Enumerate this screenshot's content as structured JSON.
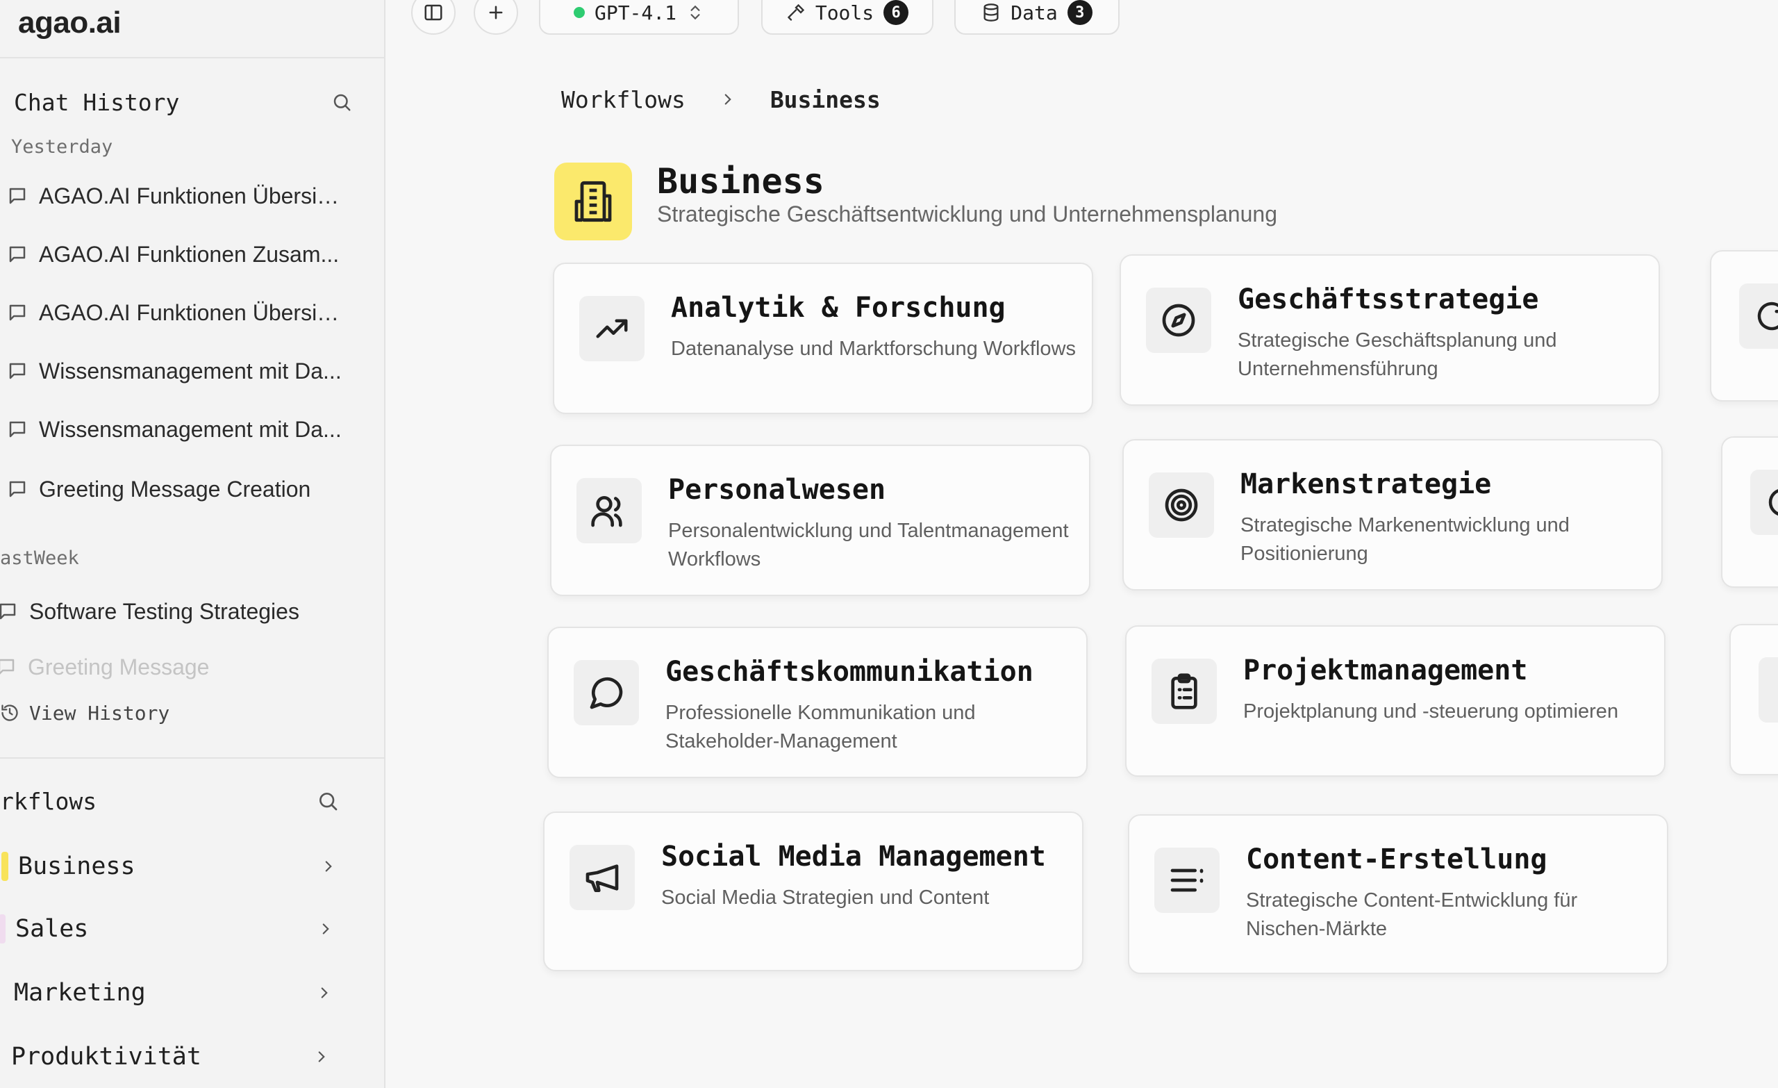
{
  "brand": "agao.ai",
  "sidebar": {
    "chat_history": {
      "title": "Chat History",
      "groups": [
        {
          "label": "Yesterday",
          "items": [
            "AGAO.AI Funktionen Übersic...",
            "AGAO.AI Funktionen Zusam...",
            "AGAO.AI Funktionen Übersic...",
            "Wissensmanagement mit Da...",
            "Wissensmanagement mit Da...",
            "Greeting Message Creation"
          ]
        },
        {
          "label": "astWeek",
          "items": [
            "Software Testing Strategies",
            "Greeting Message"
          ]
        }
      ],
      "view_history": "View History"
    },
    "workflows": {
      "title": "rkflows",
      "items": [
        "Business",
        "Sales",
        "Marketing",
        "Produktivität"
      ]
    }
  },
  "toolbar": {
    "model": "GPT-4.1",
    "tools_label": "Tools",
    "tools_count": "6",
    "data_label": "Data",
    "data_count": "3"
  },
  "breadcrumb": {
    "root": "Workflows",
    "current": "Business"
  },
  "header": {
    "title": "Business",
    "subtitle": "Strategische Geschäftsentwicklung und Unternehmensplanung"
  },
  "cards": [
    {
      "title": "Analytik & Forschung",
      "desc": "Datenanalyse und Marktforschung Workflows",
      "icon": "trending-up-icon"
    },
    {
      "title": "Geschäftsstrategie",
      "desc": "Strategische Geschäftsplanung und Unternehmensführung",
      "icon": "compass-icon"
    },
    {
      "title": "Personalwesen",
      "desc": "Personalentwicklung und Talentmanagement Workflows",
      "icon": "users-icon"
    },
    {
      "title": "Markenstrategie",
      "desc": "Strategische Markenentwicklung und Positionierung",
      "icon": "target-icon"
    },
    {
      "title": "Geschäftskommunikation",
      "desc": "Professionelle Kommunikation und Stakeholder-Management",
      "icon": "message-circle-icon"
    },
    {
      "title": "Projektmanagement",
      "desc": "Projektplanung und -steuerung optimieren",
      "icon": "clipboard-icon"
    },
    {
      "title": "Social Media Management",
      "desc": "Social Media Strategien und Content",
      "icon": "megaphone-icon"
    },
    {
      "title": "Content-Erstellung",
      "desc": "Strategische Content-Entwicklung für Nischen-Märkte",
      "icon": "list-icon"
    }
  ],
  "colors": {
    "accent_yellow": "#fbe96c",
    "status_green": "#2ecc71",
    "background": "#f7f7f7"
  }
}
